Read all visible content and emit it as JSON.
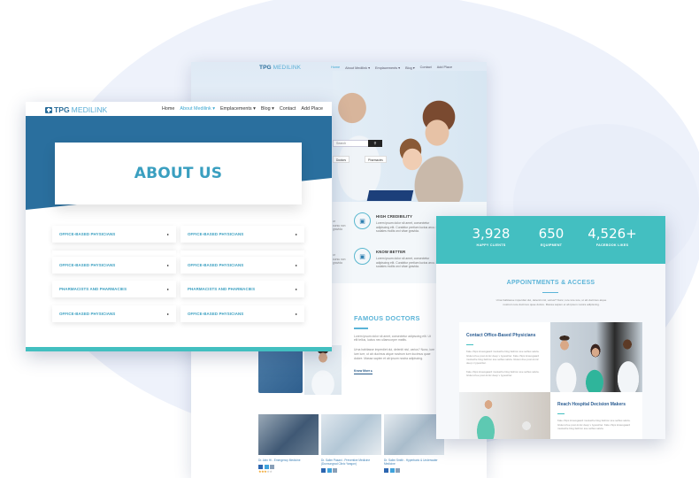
{
  "brand": {
    "logo_bold": "TPG",
    "logo_light": "MEDILINK",
    "accent_color": "#3aa6d0",
    "primary_color": "#2a6f9e",
    "teal_color": "#43bfc1"
  },
  "nav": {
    "items": [
      "Home",
      "About Medilink ▾",
      "Emplacements ▾",
      "Blog ▾",
      "Contact",
      "Add Place"
    ],
    "active_index": 1
  },
  "mid_nav": {
    "items": [
      "Home",
      "About Medilink ▾",
      "Emplacements ▾",
      "Blog ▾",
      "Contact",
      "Add Place"
    ],
    "active_index": 0
  },
  "about_page": {
    "title": "ABOUT US",
    "accordion": [
      {
        "label": "OFFICE-BASED PHYSICIANS",
        "arrow": "▸"
      },
      {
        "label": "OFFICE-BASED PHYSICIANS",
        "arrow": "▸"
      },
      {
        "label": "OFFICE-BASED PHYSICIANS",
        "arrow": "▸"
      },
      {
        "label": "OFFICE-BASED PHYSICIANS",
        "arrow": "▸"
      },
      {
        "label": "PHARMACISTS AND PHARMACIES",
        "arrow": "▸"
      },
      {
        "label": "PHARMACISTS AND PHARMACIES",
        "arrow": "▸"
      },
      {
        "label": "OFFICE-BASED PHYSICIANS",
        "arrow": "▸"
      },
      {
        "label": "OFFICE-BASED PHYSICIANS",
        "arrow": "▸"
      }
    ]
  },
  "home_page": {
    "search_placeholder": "Search",
    "search_icon": "search-icon",
    "chips": [
      "Doctors",
      "Pharmacies"
    ],
    "features": [
      {
        "title": "HIGH CREDIBILITY",
        "text": "Lorem ipsum dolor sit amet, consectetur adipiscing elit. Curabitur pretium luctus arcu. Duis sodales mollis orci vitae gravida."
      },
      {
        "title": "KNOW BETTER",
        "text": "Lorem ipsum dolor sit amet, consectetur adipiscing elit. Curabitur pretium luctus arcu. Duis sodales mollis orci vitae gravida."
      }
    ],
    "left_snippet": "ur\ncursu non\ngravida",
    "famous": {
      "title": "FAMOUS DOCTORS",
      "para1": "Lorem ipsum dolor sit amet, consectetur adipiscing elit. Ut elit tellus, luctus nec ullamcorper mattis.",
      "para2": "Urna habitasse imperdiet dui, deleniti nisl, varius? Nunc, iure iure iure, ut ab ducimus atque nostrum iure ducimus quae dolore. Massa sapien et ab ipsum nostra adipiscing.",
      "know_more": "Know More ▸"
    },
    "doctors": [
      {
        "name": "Dr. Alex Hi - Emergency Medicine",
        "rating": 3
      },
      {
        "name": "Dr. Salim Pasani - Preventive Medicine (Dunnungrad Clinic Yangon)"
      },
      {
        "name": "Dr. Salim Smith - Hyperbaric & Underwater Medicine"
      }
    ],
    "stars_full": "★★★",
    "stars_empty": "★★"
  },
  "services_page": {
    "stats": [
      {
        "value": "3,928",
        "label": "HAPPY CLIENTS"
      },
      {
        "value": "650",
        "label": "EQUIPMENT"
      },
      {
        "value": "4,526+",
        "label": "FACEBOOK LIKES"
      }
    ],
    "appointments_title": "APPOINTMENTS & ACCESS",
    "appointments_text": "Urna habitasse imperdiet dui, deleniti nisl, varius? Nunc, iure iure iure, ut ab ducimus atque nostrum iure ducimus quae dolore. Massa sapien et ab ipsum nostra adipiscing.",
    "tiles": [
      {
        "title": "Contact Office-Based Physicians",
        "text": "Kale chips knausgaard mustache blog fashion axe selfies salvia. Gluten-free post-ironic deep v typewriter. Kale chips knausgaard mustache blog fashion axe selfies salvia. Gluten-free post-ironic deep v typewriter.",
        "text2": "Kale chips knausgaard mustache blog fashion axe selfies salvia. Gluten-free post-ironic deep v typewriter."
      },
      {
        "title": "Reach Hospital Decision Makers",
        "text": "Kale chips knausgaard mustache blog fashion axe selfies salvia. Gluten-free post-ironic deep v typewriter. Kale chips knausgaard mustache blog fashion axe selfies salvia."
      }
    ]
  }
}
